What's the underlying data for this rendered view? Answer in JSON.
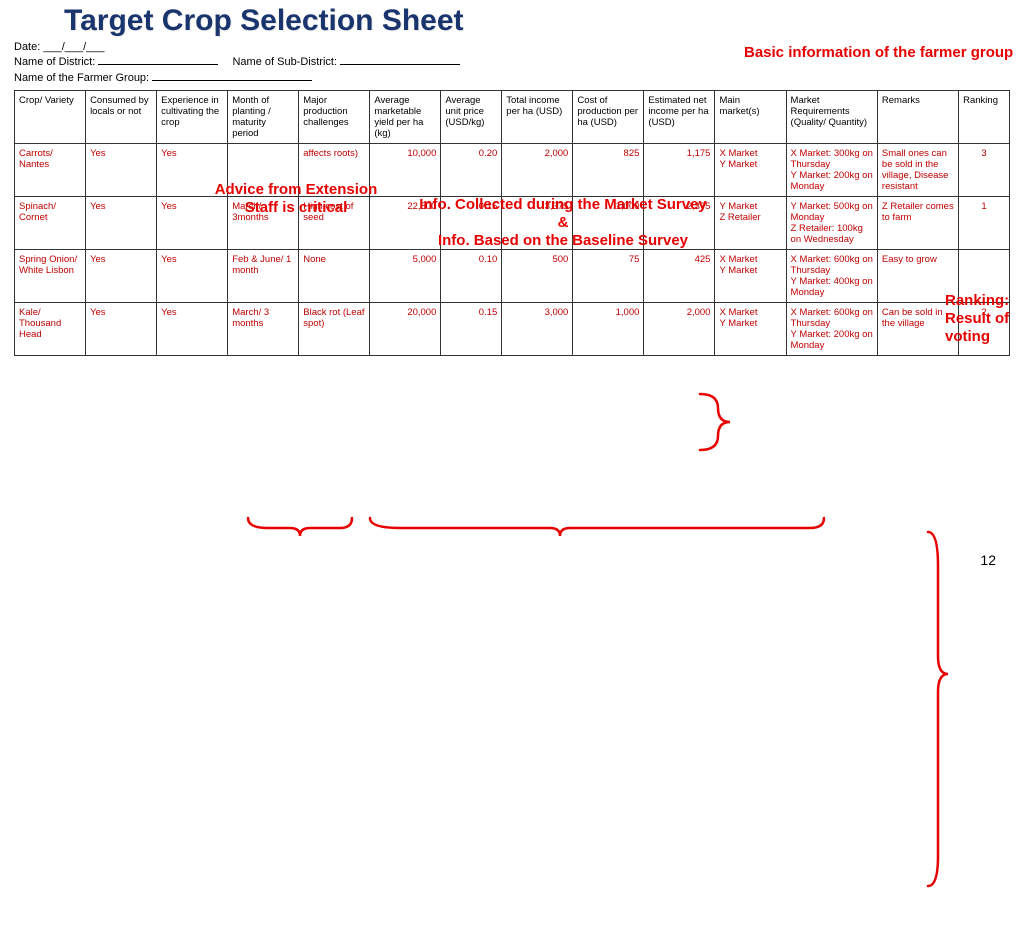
{
  "title": "Target Crop Selection Sheet",
  "meta": {
    "date_label": "Date:",
    "date_value": "___/___/___",
    "district_label": "Name of District:",
    "district_fill_width": 120,
    "subdistrict_label": "Name of Sub-District:",
    "subdistrict_fill_width": 120,
    "group_label": "Name of the Farmer Group:",
    "group_fill_width": 160
  },
  "headers": [
    "Crop/ Variety",
    "Consumed by locals or not",
    "Experience in cultivating the crop",
    "Month of planting / maturity period",
    "Major production challenges",
    "Average marketable yield per ha (kg)",
    "Average unit price (USD/kg)",
    "Total income per ha (USD)",
    "Cost of production per ha (USD)",
    "Estimated net income per ha (USD)",
    "Main market(s)",
    "Market Requirements (Quality/ Quantity)",
    "Remarks",
    "Ranking"
  ],
  "rows": [
    {
      "crop": "Carrots/ Nantes",
      "consumed": "Yes",
      "experience": "Yes",
      "month": "",
      "challenges": "affects roots)",
      "yield": "10,000",
      "price": "0.20",
      "income": "2,000",
      "cost": "825",
      "net": "1,175",
      "markets": "X Market\nY Market",
      "req": "X Market: 300kg on Thursday\nY Market: 200kg on Monday",
      "remarks": "Small ones can be sold in the village, Disease resistant",
      "rank": "3"
    },
    {
      "crop": "Spinach/ Cornet",
      "consumed": "Yes",
      "experience": "Yes",
      "month": "March/ 3months",
      "challenges": "High cost of seed",
      "yield": "22,500",
      "price": "0.15",
      "income": "3,375",
      "cost": "1,000",
      "net": "2,375",
      "markets": "Y Market\nZ Retailer",
      "req": "Y Market: 500kg on Monday\nZ Retailer: 100kg on Wednesday",
      "remarks": "Z Retailer comes to farm",
      "rank": "1"
    },
    {
      "crop": "Spring Onion/ White Lisbon",
      "consumed": "Yes",
      "experience": "Yes",
      "month": "Feb & June/ 1 month",
      "challenges": "None",
      "yield": "5,000",
      "price": "0.10",
      "income": "500",
      "cost": "75",
      "net": "425",
      "markets": "X Market\nY Market",
      "req": "X Market: 600kg on Thursday\nY Market: 400kg on Monday",
      "remarks": "Easy to grow",
      "rank": ""
    },
    {
      "crop": "Kale/ Thousand Head",
      "consumed": "Yes",
      "experience": "Yes",
      "month": "March/ 3 months",
      "challenges": "Black rot (Leaf spot)",
      "yield": "20,000",
      "price": "0.15",
      "income": "3,000",
      "cost": "1,000",
      "net": "2,000",
      "markets": "X Market\nY Market",
      "req": "X Market: 600kg on Thursday\nY Market: 200kg on Monday",
      "remarks": "Can be sold in the village",
      "rank": "2"
    }
  ],
  "annotations": {
    "basic_info": "Basic information of the farmer group",
    "advice": "Advice from Extension Staff is critical",
    "survey_line1": "Info. Collected during the Market Survey",
    "survey_line2": "&",
    "survey_line3": "Info. Based on the Baseline Survey",
    "ranking": "Ranking: Result of voting"
  },
  "pagenum": "12"
}
